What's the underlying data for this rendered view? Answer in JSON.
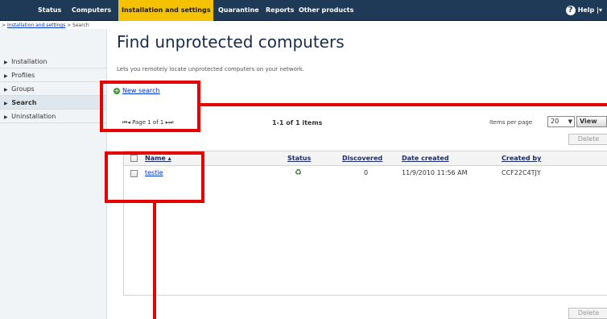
{
  "nav": {
    "tabs": [
      {
        "label": "Status"
      },
      {
        "label": "Computers"
      },
      {
        "label": "Installation and settings"
      },
      {
        "label": "Quarantine"
      },
      {
        "label": "Reports"
      },
      {
        "label": "Other products"
      }
    ],
    "help_label": "Help |",
    "help_chevron": "▾"
  },
  "breadcrumb": {
    "link": "Installation and settings",
    "current": " > Search",
    "prefix": "> "
  },
  "sidebar": {
    "items": [
      {
        "label": "Installation"
      },
      {
        "label": "Profiles"
      },
      {
        "label": "Groups"
      },
      {
        "label": "Search"
      },
      {
        "label": "Uninstallation"
      }
    ]
  },
  "main": {
    "title": "Find unprotected computers",
    "subtitle": "Lets you remotely locate unprotected computers on your network.",
    "new_search_label": "New search",
    "pager_text": "Page 1 of 1",
    "items_count": "1-1 of 1 items",
    "items_per_page_label": "Items per page",
    "items_per_page_value": "20",
    "view_label": "View",
    "delete_label": "Delete"
  },
  "table": {
    "columns": [
      "Name ▴",
      "Status",
      "Discovered",
      "Date created",
      "Created by"
    ],
    "rows": [
      {
        "name": "testie",
        "discovered": "0",
        "date_created": "11/9/2010 11:56 AM",
        "created_by": "CCF22C4TJY"
      }
    ]
  },
  "colors": {
    "nav_bg": "#1f3a57",
    "active_tab": "#f5c200",
    "annotation": "#e60000"
  }
}
